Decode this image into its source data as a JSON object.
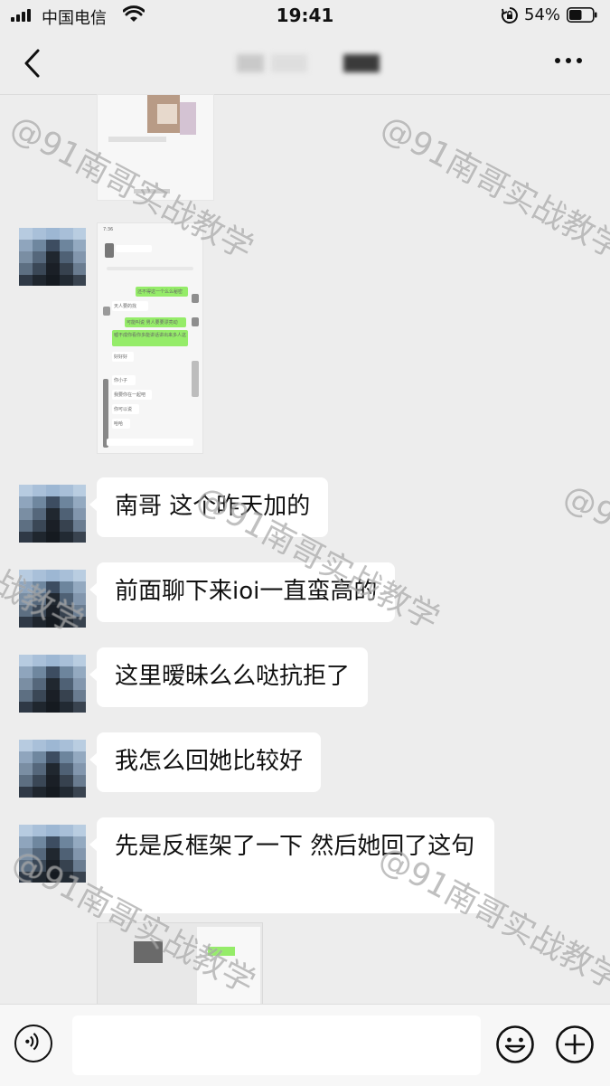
{
  "status_bar": {
    "carrier": "中国电信",
    "time": "19:41",
    "battery_percent": "54%",
    "battery_level": 0.54
  },
  "nav": {
    "back_icon": "chevron-left-icon",
    "more_icon": "ellipsis-icon"
  },
  "watermark": "@91南哥实战教学",
  "shared_image": {
    "status_time": "7:36",
    "messages": [
      "还不得这一个么么秘密",
      "天人要的找",
      "可能叫说 男人要要漂亮动",
      "嘘不成你看你多能讲话讲出来多人这",
      "好好好",
      "你小子",
      "我要你在一起吧",
      "你可以说",
      "哈哈"
    ]
  },
  "messages": [
    {
      "text": "南哥 这个昨天加的"
    },
    {
      "text": "前面聊下来ioi一直蛮高的"
    },
    {
      "text": "这里暧昧么么哒抗拒了"
    },
    {
      "text": "我怎么回她比较好"
    },
    {
      "text": "先是反框架了一下 然后她回了这句"
    }
  ],
  "input_bar": {
    "voice_icon": "voice-icon",
    "emoji_icon": "emoji-icon",
    "plus_icon": "plus-icon",
    "placeholder": ""
  }
}
